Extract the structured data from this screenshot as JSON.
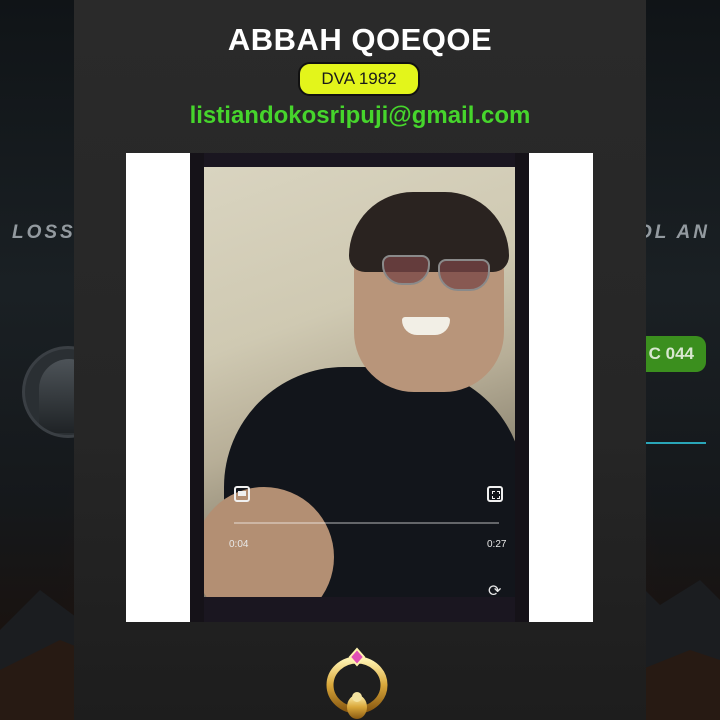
{
  "background": {
    "left_text": "LOSS",
    "right_text": "OL AN",
    "pill_text": "C 044"
  },
  "profile": {
    "name": "ABBAH QOEQOE",
    "badge": "DVA 1982",
    "email": "listiandokosripuji@gmail.com"
  },
  "video": {
    "current_time": "0:04",
    "duration": "0:27",
    "progress": 0.15
  },
  "colors": {
    "badge_bg": "#e3f51b",
    "email": "#46d52c",
    "card_bg": "#262626"
  },
  "icons": {
    "video_pip": "pip-icon",
    "video_fullscreen": "fullscreen-icon",
    "video_rotate": "rotate-icon",
    "emblem": "gold-wreath-emblem-icon"
  }
}
